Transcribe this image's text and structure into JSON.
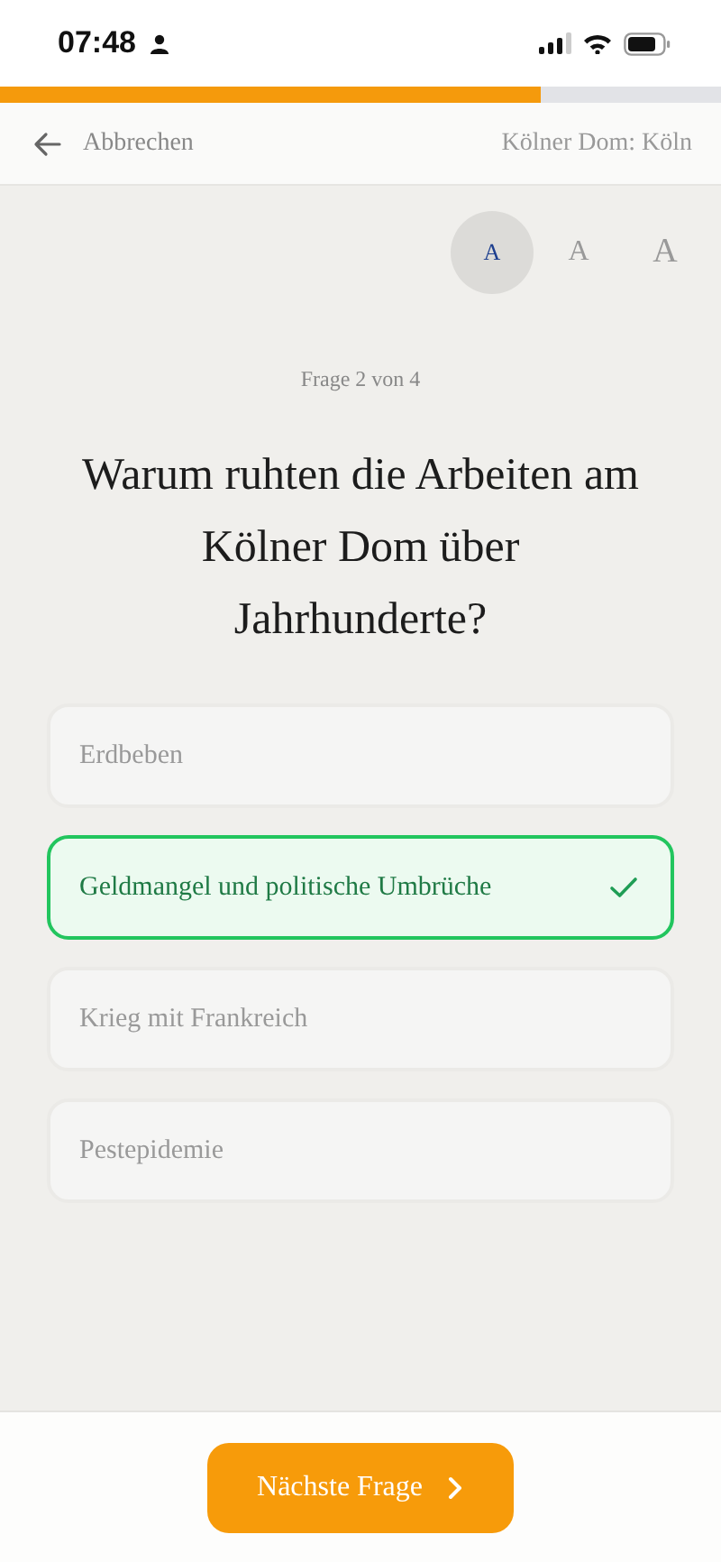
{
  "status_bar": {
    "time": "07:48"
  },
  "progress": {
    "level": 0.75
  },
  "header": {
    "back_label": "Abbrechen",
    "title": "Kölner Dom: Köln"
  },
  "font_sizes": [
    {
      "label": "A",
      "kind": "small",
      "selected": true
    },
    {
      "label": "A",
      "kind": "medium",
      "selected": false
    },
    {
      "label": "A",
      "kind": "large",
      "selected": false
    }
  ],
  "counter": "Frage 2 von 4",
  "question": "Warum ruhten die Arbeiten am Kölner Dom über Jahrhunderte?",
  "answers": [
    {
      "text": "Erdbeben",
      "selected": false
    },
    {
      "text": "Geldmangel und politische Umbrüche",
      "selected": true
    },
    {
      "text": "Krieg mit Frankreich",
      "selected": false
    },
    {
      "text": "Pestepidemie",
      "selected": false
    }
  ],
  "next_button": "Nächste Frage"
}
